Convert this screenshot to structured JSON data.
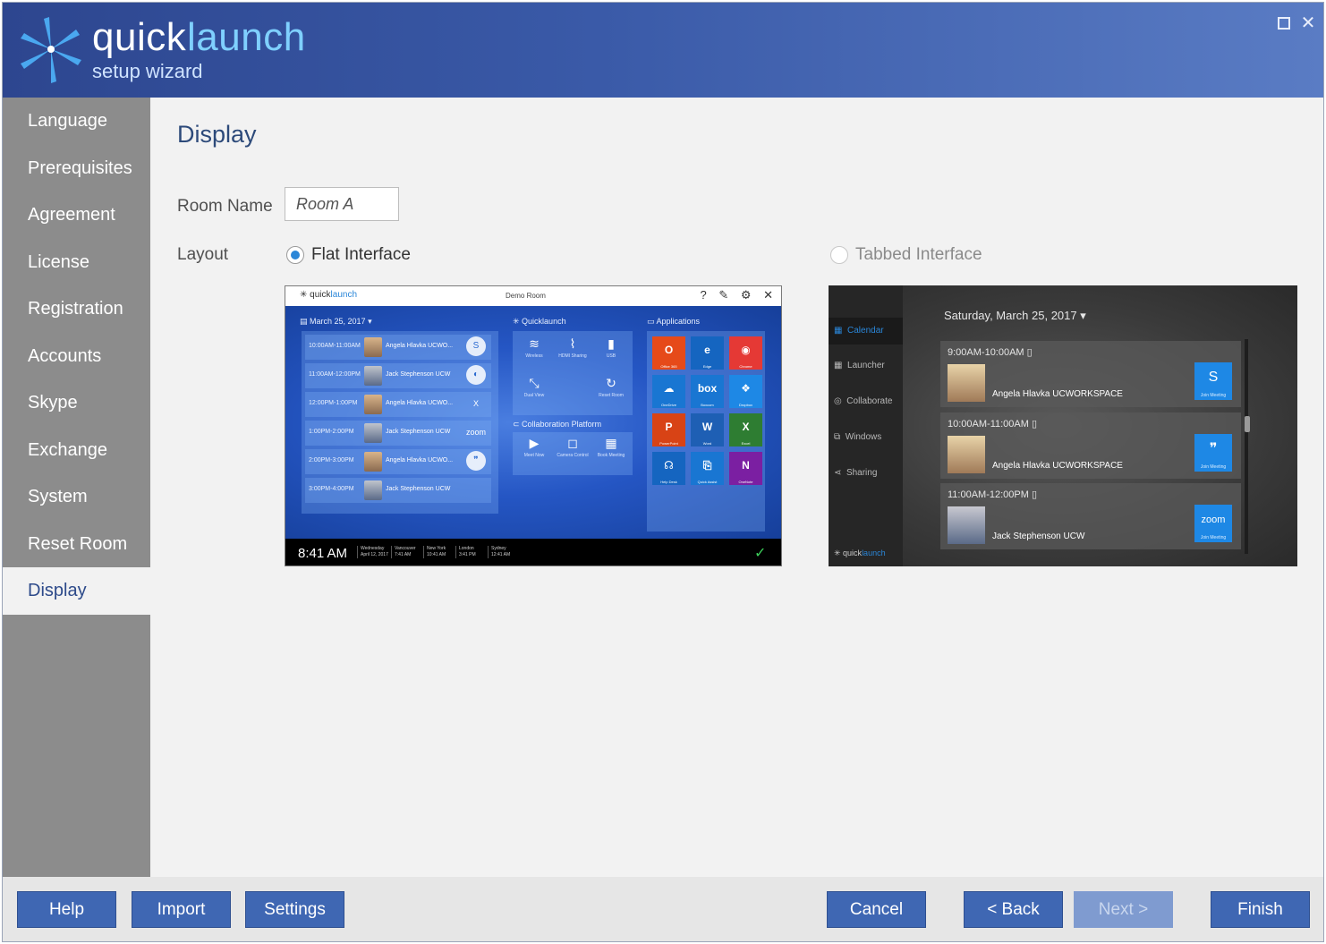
{
  "header": {
    "brand_quick": "quick",
    "brand_launch": "launch",
    "subtitle": "setup wizard",
    "close_glyph": "✕"
  },
  "sidebar": {
    "items": [
      {
        "label": "Language"
      },
      {
        "label": "Prerequisites"
      },
      {
        "label": "Agreement"
      },
      {
        "label": "License"
      },
      {
        "label": "Registration"
      },
      {
        "label": "Accounts"
      },
      {
        "label": "Skype"
      },
      {
        "label": "Exchange"
      },
      {
        "label": "System"
      },
      {
        "label": "Reset Room"
      },
      {
        "label": "Display"
      }
    ],
    "active_index": 10
  },
  "main": {
    "title": "Display",
    "room_name_label": "Room Name",
    "room_name_value": "Room A",
    "layout_label": "Layout",
    "options": [
      {
        "label": "Flat Interface",
        "selected": true,
        "enabled": true
      },
      {
        "label": "Tabbed Interface",
        "selected": false,
        "enabled": false
      }
    ]
  },
  "flat_preview": {
    "logo_quick": "quick",
    "logo_launch": "launch",
    "room": "Demo Room",
    "title_icons": "? ✎ ⚙ ✕",
    "calendar_title": "March 25, 2017",
    "quicklaunch_title": "Quicklaunch",
    "applications_title": "Applications",
    "collab_title": "Collaboration Platform",
    "meetings": [
      {
        "time": "10:00AM-11:00AM",
        "name": "Angela Hlavka UCWO...",
        "icon": "S"
      },
      {
        "time": "11:00AM-12:00PM",
        "name": "Jack Stephenson UCW",
        "icon": "◐"
      },
      {
        "time": "12:00PM-1:00PM",
        "name": "Angela Hlavka UCWO...",
        "icon": "X"
      },
      {
        "time": "1:00PM-2:00PM",
        "name": "Jack Stephenson UCW",
        "icon": "zoom"
      },
      {
        "time": "2:00PM-3:00PM",
        "name": "Angela Hlavka UCWO...",
        "icon": "❞"
      },
      {
        "time": "3:00PM-4:00PM",
        "name": "Jack Stephenson UCW",
        "icon": ""
      }
    ],
    "ql_tiles": [
      {
        "icon": "≋",
        "label": "Wireless"
      },
      {
        "icon": "⌇",
        "label": "HDMI Sharing"
      },
      {
        "icon": "▮",
        "label": "USB"
      },
      {
        "icon": "⤡",
        "label": "Dual View"
      },
      {
        "icon": "↻",
        "label": "Reset Room"
      }
    ],
    "collab_tiles": [
      {
        "icon": "▶",
        "label": "Meet Now"
      },
      {
        "icon": "◻",
        "label": "Camera Control"
      },
      {
        "icon": "▦",
        "label": "Book Meeting"
      }
    ],
    "app_tiles": [
      {
        "icon": "O",
        "label": "Office 365",
        "color": "#e64a19"
      },
      {
        "icon": "e",
        "label": "Edge",
        "color": "#1565c0"
      },
      {
        "icon": "◉",
        "label": "Chrome",
        "color": "#e53935"
      },
      {
        "icon": "☁",
        "label": "OneDrive",
        "color": "#1976d2"
      },
      {
        "icon": "box",
        "label": "Boxcom",
        "color": "#1976d2"
      },
      {
        "icon": "❖",
        "label": "Dropbox",
        "color": "#1e88e5"
      },
      {
        "icon": "P",
        "label": "PowerPoint",
        "color": "#d84315"
      },
      {
        "icon": "W",
        "label": "Word",
        "color": "#1e5fb4"
      },
      {
        "icon": "X",
        "label": "Excel",
        "color": "#2e7d32"
      },
      {
        "icon": "☊",
        "label": "Help Desk",
        "color": "#1565c0"
      },
      {
        "icon": "⎘",
        "label": "Quick Assist",
        "color": "#1976d2"
      },
      {
        "icon": "N",
        "label": "OneNote",
        "color": "#7b1fa2"
      }
    ],
    "clock": "8:41 AM",
    "cities": [
      {
        "line1": "Wednesday",
        "line2": "April 12, 2017"
      },
      {
        "line1": "Vancouver",
        "line2": "7:41 AM"
      },
      {
        "line1": "New York",
        "line2": "10:41 AM"
      },
      {
        "line1": "London",
        "line2": "3:41 PM"
      },
      {
        "line1": "Sydney",
        "line2": "12:41 AM"
      }
    ],
    "shield": "✓"
  },
  "tabbed_preview": {
    "nav": [
      {
        "label": "Calendar"
      },
      {
        "label": "Launcher"
      },
      {
        "label": "Collaborate"
      },
      {
        "label": "Windows"
      },
      {
        "label": "Sharing"
      }
    ],
    "logo_quick": "quick",
    "logo_launch": "launch",
    "date": "Saturday, March 25, 2017",
    "meetings": [
      {
        "time": "9:00AM-10:00AM",
        "name": "Angela Hlavka UCWORKSPACE",
        "join": "S",
        "join_label": "Join Meeting"
      },
      {
        "time": "10:00AM-11:00AM",
        "name": "Angela Hlavka UCWORKSPACE",
        "join": "❞",
        "join_label": "Join Meeting"
      },
      {
        "time": "11:00AM-12:00PM",
        "name": "Jack Stephenson UCW",
        "join": "zoom",
        "join_label": "Join Meeting"
      }
    ]
  },
  "footer": {
    "help": "Help",
    "import": "Import",
    "settings": "Settings",
    "cancel": "Cancel",
    "back": "< Back",
    "next": "Next >",
    "finish": "Finish"
  },
  "colors": {
    "header_start": "#2d468f",
    "accent": "#3f67b3",
    "sidebar": "#8c8c8c",
    "radio_selected": "#2a86d8"
  }
}
